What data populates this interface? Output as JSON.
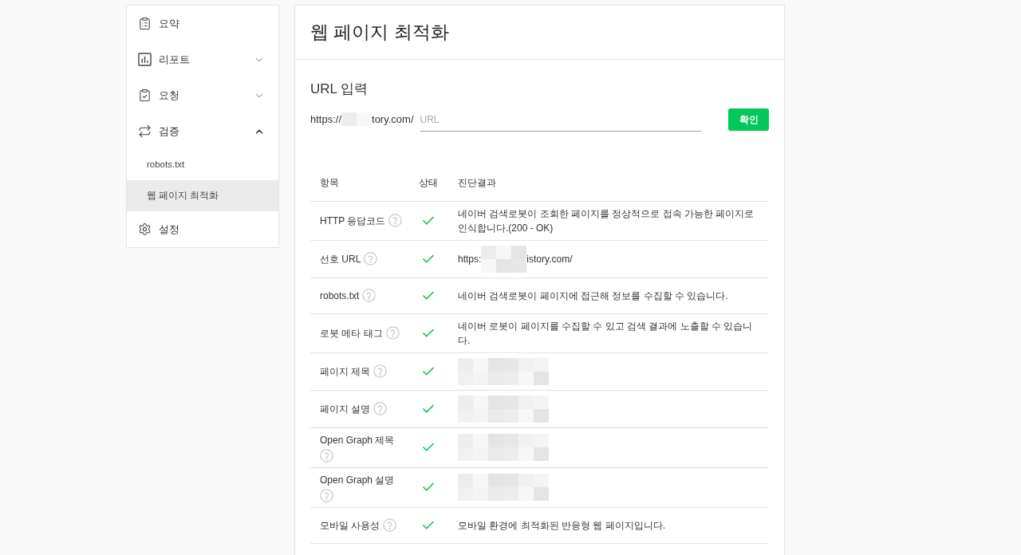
{
  "sidebar": {
    "items": [
      {
        "label": "요약",
        "kind": "link",
        "selected": false
      },
      {
        "label": "리포트",
        "kind": "group",
        "expanded": false,
        "selected": false
      },
      {
        "label": "요청",
        "kind": "group",
        "expanded": false,
        "selected": false
      },
      {
        "label": "검증",
        "kind": "group",
        "expanded": true,
        "selected": false,
        "children": [
          {
            "label": "robots.txt",
            "selected": false
          },
          {
            "label": "웹 페이지 최적화",
            "selected": true
          }
        ]
      },
      {
        "label": "설정",
        "kind": "link",
        "selected": false
      }
    ]
  },
  "page": {
    "title": "웹 페이지 최적화"
  },
  "url_form": {
    "heading": "URL 입력",
    "prefix_start": "https://",
    "prefix_end": "tory.com/",
    "placeholder": "URL",
    "button": "확인"
  },
  "table": {
    "columns": [
      "항목",
      "상태",
      "진단결과"
    ],
    "rows": [
      {
        "item": "HTTP 응답코드",
        "passed": true,
        "result": {
          "kind": "text",
          "text": "네이버 검색로봇이 조회한 페이지를 정상적으로 접속 가능한 페이지로 인식합니다.(200 - OK)"
        }
      },
      {
        "item": "선호 URL",
        "passed": true,
        "result": {
          "kind": "url",
          "start": "https:",
          "end": "istory.com/"
        }
      },
      {
        "item": "robots.txt",
        "passed": true,
        "result": {
          "kind": "text",
          "text": "네이버 검색로봇이 페이지에 접근해 정보를 수집할 수 있습니다."
        }
      },
      {
        "item": "로봇 메타 태그",
        "passed": true,
        "result": {
          "kind": "text",
          "text": "네이버 로봇이 페이지를 수집할 수 있고 검색 결과에 노출할 수 있습니다."
        }
      },
      {
        "item": "페이지 제목",
        "passed": true,
        "result": {
          "kind": "redacted"
        }
      },
      {
        "item": "페이지 설명",
        "passed": true,
        "result": {
          "kind": "redacted"
        }
      },
      {
        "item": "Open Graph 제목",
        "passed": true,
        "result": {
          "kind": "redacted"
        }
      },
      {
        "item": "Open Graph 설명",
        "passed": true,
        "result": {
          "kind": "redacted"
        }
      },
      {
        "item": "모바일 사용성",
        "passed": true,
        "result": {
          "kind": "text",
          "text": "모바일 환경에 최적화된 반응형 웹 페이지입니다."
        }
      }
    ]
  }
}
